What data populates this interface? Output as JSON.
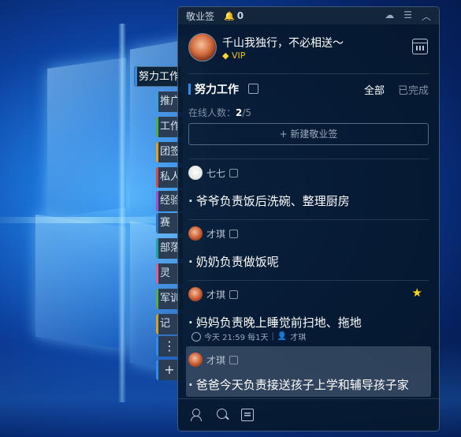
{
  "app": {
    "title": "敬业签",
    "notif_count": "0"
  },
  "user": {
    "name": "千山我独行，不必相送～",
    "vip": "VIP"
  },
  "section": {
    "title": "努力工作",
    "filter_all": "全部",
    "filter_done": "已完成"
  },
  "online": {
    "label": "在线人数：",
    "current": "2",
    "total": "/5"
  },
  "new_button": "+ 新建敬业签",
  "sidebar_tabs": [
    {
      "label": "努力工作",
      "color": "#2d8cf0"
    },
    {
      "label": "推广",
      "color": "#3aa0e0"
    },
    {
      "label": "工作",
      "color": "#4ab04a"
    },
    {
      "label": "团签",
      "color": "#e0a020"
    },
    {
      "label": "私人",
      "color": "#d24a4a"
    },
    {
      "label": "经验",
      "color": "#a050d0"
    },
    {
      "label": "赛",
      "color": "#3070c0"
    },
    {
      "label": "部落",
      "color": "#20a0a0"
    },
    {
      "label": "灵",
      "color": "#e06090"
    },
    {
      "label": "军训",
      "color": "#50b050"
    },
    {
      "label": "记",
      "color": "#d0a030"
    },
    {
      "label": "⋮",
      "color": "#2d8cf0"
    },
    {
      "label": "+",
      "color": "#2d8cf0"
    }
  ],
  "items": [
    {
      "author": "七七",
      "text": "爷爷负责饭后洗碗、整理厨房"
    },
    {
      "author": "才琪",
      "text": "奶奶负责做饭呢"
    },
    {
      "author": "才琪",
      "text": "妈妈负责晚上睡觉前扫地、拖地",
      "starred": true,
      "meta_time": "今天 21:59 每1天",
      "meta_assignee": "才琪"
    },
    {
      "author": "才琪",
      "text": "爸爸今天负责接送孩子上学和辅导孩子家"
    }
  ],
  "icons": {
    "bell": "bell-icon",
    "cloud": "cloud-icon",
    "menu": "menu-icon",
    "collapse": "chevron-up-icon",
    "calendar": "calendar-icon",
    "star": "star-icon",
    "users": "users-icon",
    "search": "search-icon",
    "note": "note-icon"
  },
  "colors": {
    "accent": "#2d8cf0",
    "star": "#ffd21c",
    "vip": "#f3c320",
    "panel_bg": "#07182c"
  }
}
